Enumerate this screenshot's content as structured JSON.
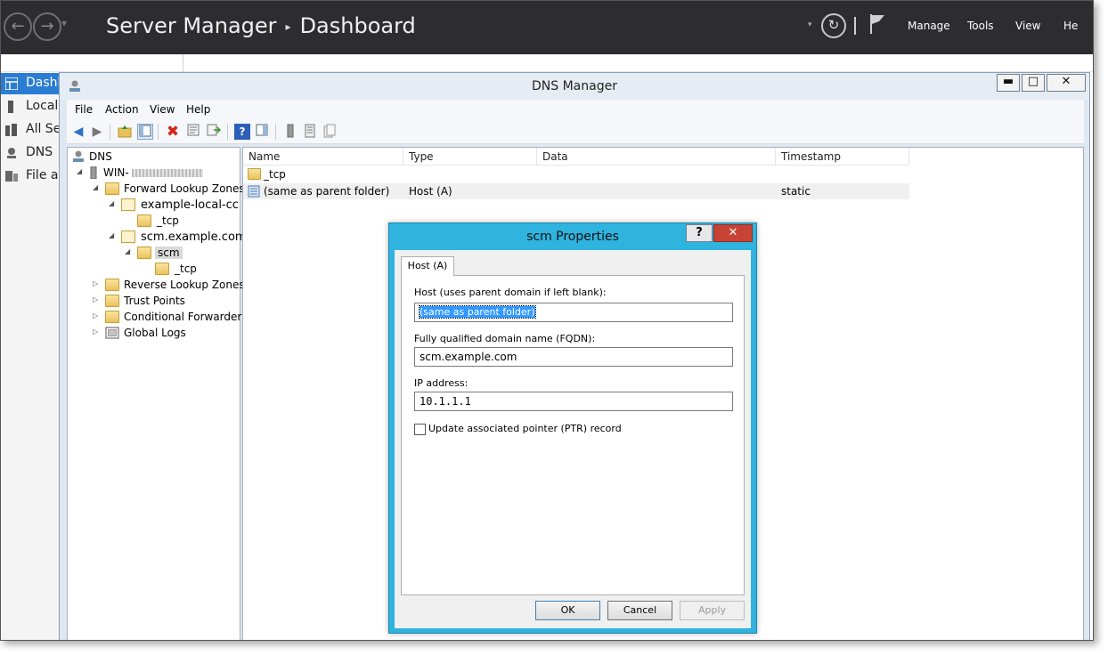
{
  "server_manager": {
    "title": "Server Manager",
    "separator": "▸",
    "page": "Dashboard",
    "menu": [
      "Manage",
      "Tools",
      "View",
      "He"
    ],
    "nav": [
      {
        "label": "Dashb"
      },
      {
        "label": "Local"
      },
      {
        "label": "All Se"
      },
      {
        "label": "DNS"
      },
      {
        "label": "File ar"
      }
    ]
  },
  "dns_window": {
    "title": "DNS Manager",
    "controls": {
      "minimize": "▬",
      "maximize": "□",
      "close": "✕"
    },
    "menu": [
      "File",
      "Action",
      "View",
      "Help"
    ],
    "tree": {
      "root": "DNS",
      "server": "WIN-",
      "forward_zones": "Forward Lookup Zones",
      "zone1": "example-local-cc",
      "zone1_child": "_tcp",
      "zone2": "scm.example.com",
      "zone2_child": "scm",
      "zone2_grandchild": "_tcp",
      "reverse_zones": "Reverse Lookup Zones",
      "trust_points": "Trust Points",
      "conditional_forwarders": "Conditional Forwarders",
      "global_logs": "Global Logs"
    },
    "list": {
      "columns": [
        "Name",
        "Type",
        "Data",
        "Timestamp"
      ],
      "rows": [
        {
          "name": "_tcp",
          "type": "",
          "data": "",
          "timestamp": ""
        },
        {
          "name": "(same as parent folder)",
          "type": "Host (A)",
          "data": "",
          "timestamp": "static"
        }
      ]
    }
  },
  "dialog": {
    "title": "scm Properties",
    "help": "?",
    "close": "✕",
    "tab": "Host (A)",
    "host_label": "Host (uses parent domain if left blank):",
    "host_value": "(same as parent folder)",
    "fqdn_label": "Fully qualified domain name (FQDN):",
    "fqdn_value": "scm.example.com",
    "ip_label": "IP address:",
    "ip_value": "10.1.1.1",
    "ptr_label": "Update associated pointer (PTR) record",
    "buttons": {
      "ok": "OK",
      "cancel": "Cancel",
      "apply": "Apply"
    }
  }
}
